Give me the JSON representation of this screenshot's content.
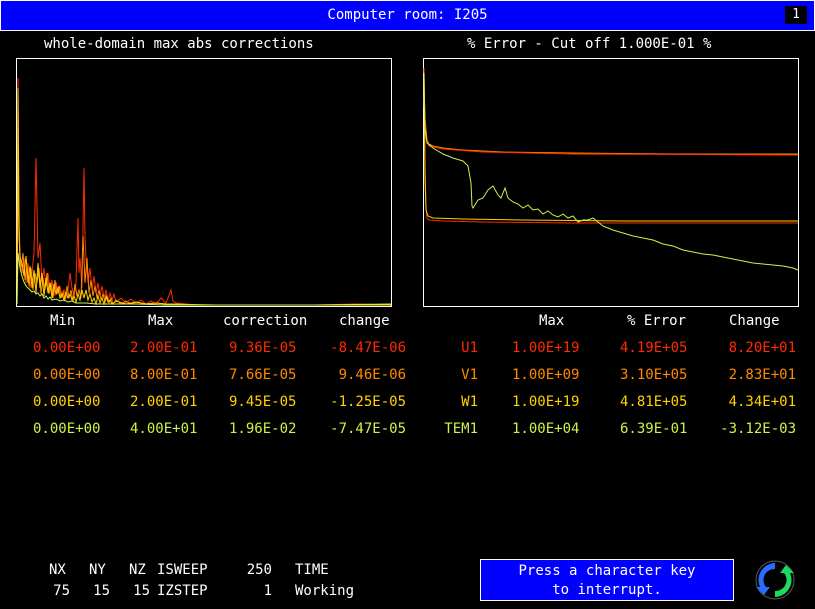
{
  "window": {
    "title": "Computer room: I205",
    "number": "1"
  },
  "left_plot": {
    "title": "whole-domain max abs corrections"
  },
  "right_plot": {
    "title": "% Error - Cut off 1.000E-01 %"
  },
  "left_table": {
    "headers": [
      "Min",
      "Max",
      "correction",
      "change"
    ],
    "rows": [
      {
        "color": "#ff2a00",
        "cells": [
          "0.00E+00",
          "2.00E-01",
          "9.36E-05",
          "-8.47E-06"
        ]
      },
      {
        "color": "#ff8a00",
        "cells": [
          "0.00E+00",
          "8.00E-01",
          "7.66E-05",
          "9.46E-06"
        ]
      },
      {
        "color": "#ffd200",
        "cells": [
          "0.00E+00",
          "2.00E-01",
          "9.45E-05",
          "-1.25E-05"
        ]
      },
      {
        "color": "#ccf34a",
        "cells": [
          "0.00E+00",
          "4.00E+01",
          "1.96E-02",
          "-7.47E-05"
        ]
      }
    ]
  },
  "right_table": {
    "headers": [
      "Max",
      "% Error",
      "Change"
    ],
    "rows": [
      {
        "color": "#ff2a00",
        "cells": [
          "U1",
          "1.00E+19",
          "4.19E+05",
          "8.20E+01"
        ]
      },
      {
        "color": "#ff8a00",
        "cells": [
          "V1",
          "1.00E+09",
          "3.10E+05",
          "2.83E+01"
        ]
      },
      {
        "color": "#ffd200",
        "cells": [
          "W1",
          "1.00E+19",
          "4.81E+05",
          "4.34E+01"
        ]
      },
      {
        "color": "#ccf34a",
        "cells": [
          "TEM1",
          "1.00E+04",
          "6.39E-01",
          "-3.12E-03"
        ]
      }
    ]
  },
  "status": {
    "nx_label": "NX",
    "ny_label": "NY",
    "nz_label": "NZ",
    "isweep_label": "ISWEEP",
    "isweep_value": "250",
    "time_label": "TIME",
    "nx": "75",
    "ny": "15",
    "nz": "15",
    "izstep_label": "IZSTEP",
    "izstep_value": "1",
    "state": "Working"
  },
  "interrupt": {
    "line1": "Press a character key",
    "line2": "to interrupt."
  },
  "colors": {
    "title_bg": "#0000ff",
    "red": "#ff2a00",
    "orange": "#ff8a00",
    "yellow": "#ffd200",
    "lime": "#ccf34a"
  },
  "icons": {
    "logo": "phoenics-swirl-logo-icon"
  }
}
